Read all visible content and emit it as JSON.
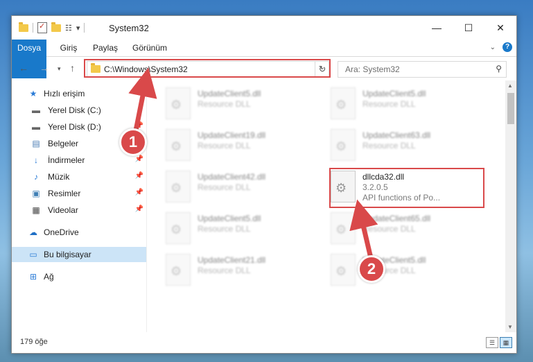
{
  "window": {
    "title": "System32",
    "controls": {
      "minimize": "—",
      "maximize": "☐",
      "close": "✕"
    }
  },
  "ribbon": {
    "tabs": [
      "Dosya",
      "Giriş",
      "Paylaş",
      "Görünüm"
    ],
    "expand_icon": "chevron-down-icon",
    "help": "?"
  },
  "address": {
    "path": "C:\\Windows\\System32",
    "search_placeholder": "Ara: System32"
  },
  "sidebar": {
    "items": [
      {
        "label": "Hızlı erişim",
        "icon": "star-icon",
        "pinned": false
      },
      {
        "label": "Yerel Disk (C:)",
        "icon": "drive-icon",
        "pinned": false
      },
      {
        "label": "Yerel Disk (D:)",
        "icon": "drive-icon",
        "pinned": true
      },
      {
        "label": "Belgeler",
        "icon": "document-icon",
        "pinned": true
      },
      {
        "label": "İndirmeler",
        "icon": "download-icon",
        "pinned": true
      },
      {
        "label": "Müzik",
        "icon": "music-icon",
        "pinned": true
      },
      {
        "label": "Resimler",
        "icon": "pictures-icon",
        "pinned": true
      },
      {
        "label": "Videolar",
        "icon": "video-icon",
        "pinned": true
      },
      {
        "label": "OneDrive",
        "icon": "cloud-icon",
        "pinned": false
      },
      {
        "label": "Bu bilgisayar",
        "icon": "computer-icon",
        "pinned": false,
        "selected": true
      },
      {
        "label": "Ağ",
        "icon": "network-icon",
        "pinned": false
      }
    ]
  },
  "files": {
    "left": [
      {
        "name": "UpdateClient5.dll",
        "desc": "Resource DLL"
      },
      {
        "name": "UpdateClient19.dll",
        "desc": "Resource DLL"
      },
      {
        "name": "UpdateClient42.dll",
        "desc": "Resource DLL"
      },
      {
        "name": "UpdateClient5.dll",
        "desc": "Resource DLL"
      },
      {
        "name": "UpdateClient21.dll",
        "desc": "Resource DLL"
      }
    ],
    "right": [
      {
        "name": "UpdateClient5.dll",
        "desc": "Resource DLL"
      },
      {
        "name": "UpdateClient63.dll",
        "desc": "Resource DLL"
      },
      {
        "name": "UpdateClient65.dll",
        "desc": "Resource DLL"
      },
      {
        "name": "UpdateClient5.dll",
        "desc": "Resource DLL"
      }
    ],
    "highlighted": {
      "name": "dllcda32.dll",
      "version": "3.2.0.5",
      "desc": "API functions of Po..."
    }
  },
  "status": {
    "item_count": "179 öğe"
  },
  "annotations": {
    "step1": "1",
    "step2": "2",
    "color": "#d9494a"
  }
}
